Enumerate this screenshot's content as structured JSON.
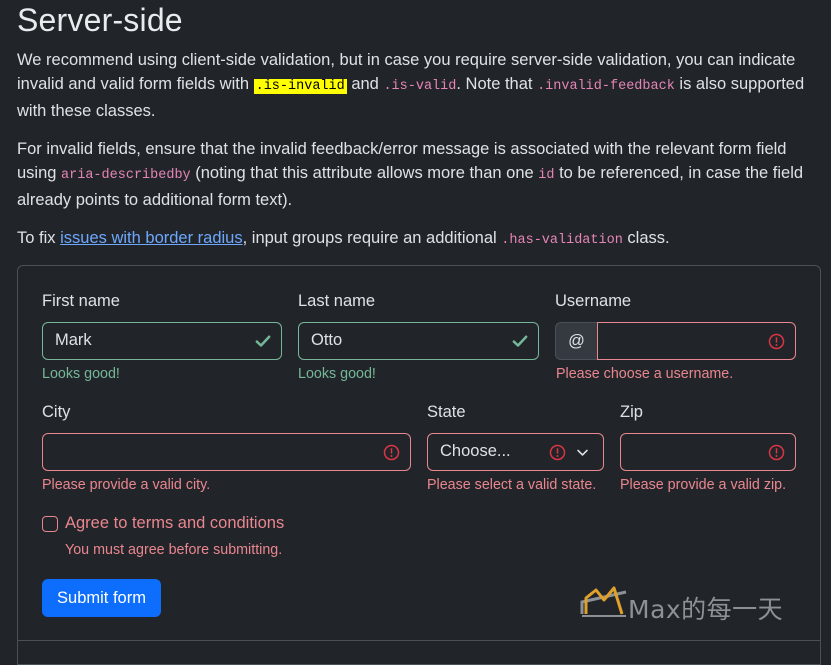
{
  "heading": "Server-side",
  "intro": {
    "t1": "We recommend using client-side validation, but in case you require server-side validation, you can indicate invalid and valid form fields with ",
    "code1": ".is-invalid",
    "t2": " and ",
    "code2": ".is-valid",
    "t3": ". Note that ",
    "code3": ".invalid-feedback",
    "t4": " is also supported with these classes."
  },
  "note": {
    "t1": "For invalid fields, ensure that the invalid feedback/error message is associated with the relevant form field using ",
    "code1": "aria-describedby",
    "t2": " (noting that this attribute allows more than one ",
    "code2": "id",
    "t3": " to be referenced, in case the field already points to additional form text)."
  },
  "fix": {
    "t1": "To fix ",
    "link": "issues with border radius",
    "t2": ", input groups require an additional ",
    "code": ".has-validation",
    "t3": " class."
  },
  "form": {
    "first_name": {
      "label": "First name",
      "value": "Mark",
      "feedback": "Looks good!"
    },
    "last_name": {
      "label": "Last name",
      "value": "Otto",
      "feedback": "Looks good!"
    },
    "username": {
      "label": "Username",
      "prefix": "@",
      "value": "",
      "feedback": "Please choose a username."
    },
    "city": {
      "label": "City",
      "value": "",
      "feedback": "Please provide a valid city."
    },
    "state": {
      "label": "State",
      "selected": "Choose...",
      "feedback": "Please select a valid state."
    },
    "zip": {
      "label": "Zip",
      "value": "",
      "feedback": "Please provide a valid zip."
    },
    "terms": {
      "label": "Agree to terms and conditions",
      "feedback": "You must agree before submitting."
    },
    "submit_label": "Submit form"
  },
  "watermark": {
    "text": "Max的每一天",
    "icon": "max-logo-icon"
  },
  "colors": {
    "background": "#212529",
    "valid": "#75b798",
    "invalid": "#ea868f",
    "primary": "#0d6efd",
    "link": "#6ea8fe",
    "code": "#e685b5",
    "highlight": "#ffff00"
  }
}
